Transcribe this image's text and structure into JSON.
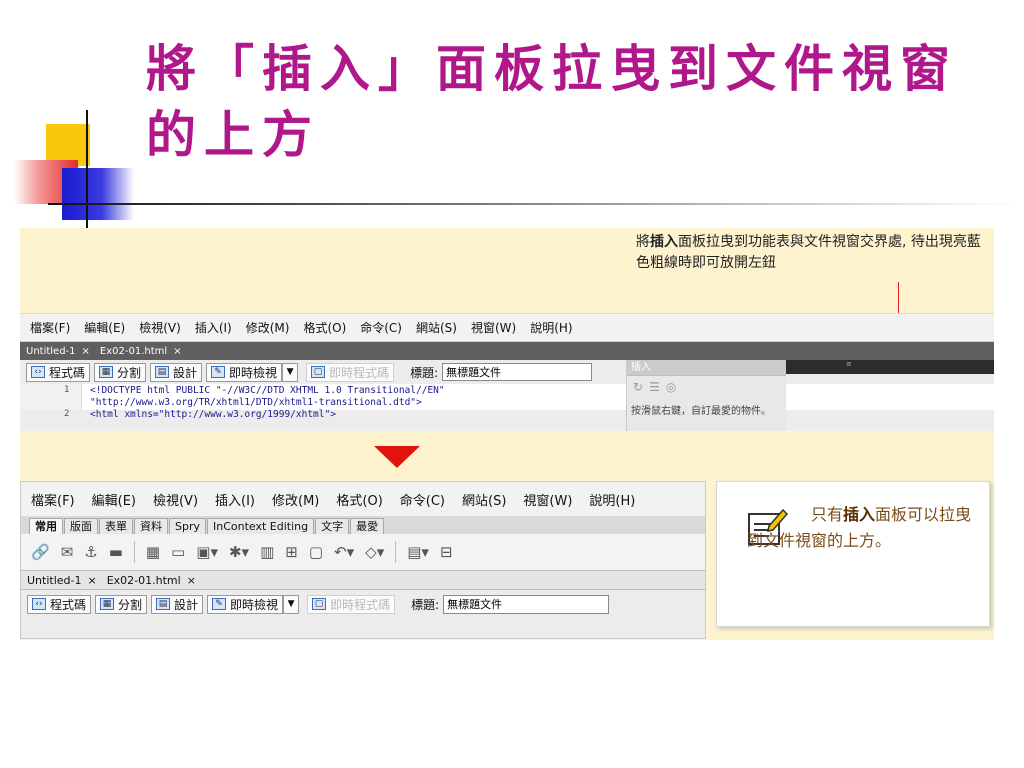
{
  "slide": {
    "title": "將「插入」面板拉曳到文件視窗的上方"
  },
  "callout_top": {
    "prefix": "將",
    "bold": "插入",
    "suffix": "面板拉曳到功能表與文件視窗交界處, 待出現亮藍色粗線時即可放開左鈕"
  },
  "top_window": {
    "menu": [
      "檔案(F)",
      "編輯(E)",
      "檢視(V)",
      "插入(I)",
      "修改(M)",
      "格式(O)",
      "命令(C)",
      "網站(S)",
      "視窗(W)",
      "說明(H)"
    ],
    "tabs": [
      "Untitled-1",
      "Ex02-01.html"
    ],
    "tab_close": "×",
    "toolbar": {
      "code": "程式碼",
      "split": "分割",
      "design": "設計",
      "live_view": "即時檢視",
      "live_code": "即時程式碼",
      "title_label": "標題:",
      "title_value": "無標題文件"
    },
    "code": {
      "line_numbers": [
        "1",
        "2"
      ],
      "lines": [
        "<!DOCTYPE html PUBLIC \"-//W3C//DTD XHTML 1.0 Transitional//EN\"",
        "\"http://www.w3.org/TR/xhtml1/DTD/xhtml1-transitional.dtd\">",
        "<html xmlns=\"http://www.w3.org/1999/xhtml\">"
      ]
    },
    "insert_panel": {
      "title": "插入",
      "hint": "按滑鼠右鍵，自訂最愛的物件。"
    }
  },
  "bottom_window": {
    "menu": [
      "檔案(F)",
      "編輯(E)",
      "檢視(V)",
      "插入(I)",
      "修改(M)",
      "格式(O)",
      "命令(C)",
      "網站(S)",
      "視窗(W)",
      "說明(H)"
    ],
    "categories": [
      "常用",
      "版面",
      "表單",
      "資料",
      "Spry",
      "InContext Editing",
      "文字",
      "最愛"
    ],
    "tabs": [
      "Untitled-1",
      "Ex02-01.html"
    ],
    "tab_close": "×",
    "toolbar": {
      "code": "程式碼",
      "split": "分割",
      "design": "設計",
      "live_view": "即時檢視",
      "live_code": "即時程式碼",
      "title_label": "標題:",
      "title_value": "無標題文件"
    }
  },
  "note": {
    "prefix": "只有",
    "bold": "插入",
    "suffix": "面板可以拉曳到文件視窗的上方。"
  },
  "colors": {
    "title": "#b0178a",
    "panel_bg": "#fdf3cf",
    "arrow": "#e2140c",
    "note_text": "#7a4e1a"
  }
}
